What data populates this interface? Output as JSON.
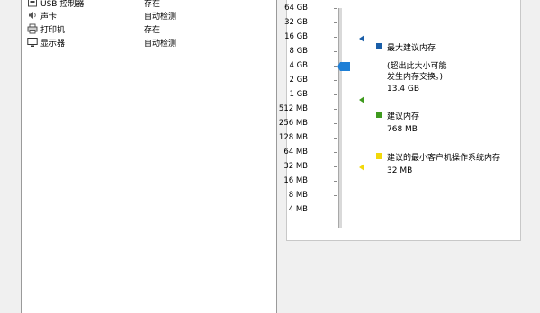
{
  "hardware_list": [
    {
      "icon": "usb-controller-icon",
      "name": "USB 控制器",
      "status": "存在"
    },
    {
      "icon": "sound-card-icon",
      "name": "声卡",
      "status": "自动检测"
    },
    {
      "icon": "printer-icon",
      "name": "打印机",
      "status": "存在"
    },
    {
      "icon": "display-icon",
      "name": "显示器",
      "status": "自动检测"
    }
  ],
  "memory": {
    "scale_labels": [
      "64 GB",
      "32 GB",
      "16 GB",
      "8 GB",
      "4 GB",
      "2 GB",
      "1 GB",
      "512 MB",
      "256 MB",
      "128 MB",
      "64 MB",
      "32 MB",
      "16 MB",
      "8 MB",
      "4 MB"
    ],
    "current_value": "4 GB",
    "max_recommended": {
      "label": "最大建议内存",
      "note_line1": "(超出此大小可能",
      "note_line2": "发生内存交换。)",
      "value": "13.4 GB",
      "color": "#1a5ea8"
    },
    "recommended": {
      "label": "建议内存",
      "value": "768 MB",
      "color": "#3e9a1e"
    },
    "min_guest_os": {
      "label": "建议的最小客户机操作系统内存",
      "value": "32 MB",
      "color": "#f2d80a"
    },
    "thumb_color": "#1e7fd6"
  }
}
